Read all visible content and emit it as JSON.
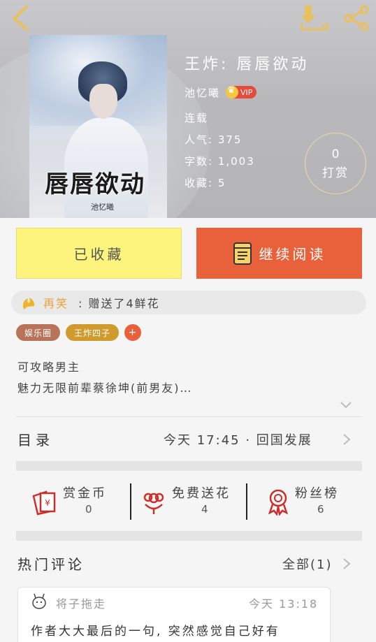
{
  "book": {
    "cover_title": "唇唇欲动",
    "cover_author": "池忆曦",
    "title": "王炸: 唇唇欲动",
    "author": "池忆曦",
    "vip_label": "VIP",
    "status": "连载",
    "popularity": "人气: 375",
    "word_count": "字数: 1,003",
    "favorites": "收藏: 5"
  },
  "tip": {
    "count": "0",
    "label": "打赏"
  },
  "actions": {
    "collect_label": "已收藏",
    "read_label": "继续阅读"
  },
  "gift": {
    "user": "再笑",
    "text": ": 赠送了4鲜花"
  },
  "tags": [
    "娱乐圈",
    "王炸四子"
  ],
  "tag_add": "+",
  "description": [
    "可攻略男主",
    "魅力无限前辈蔡徐坤(前男友)…"
  ],
  "toc": {
    "label": "目录",
    "latest": "今天 17:45 · 回国发展"
  },
  "stats": [
    {
      "label": "赏金币",
      "value": "0",
      "icon": "red-envelope-icon"
    },
    {
      "label": "免费送花",
      "value": "4",
      "icon": "flower-icon"
    },
    {
      "label": "粉丝榜",
      "value": "6",
      "icon": "medal-icon"
    }
  ],
  "comments_section": {
    "title": "热门评论",
    "all_label": "全部(1)"
  },
  "comment": {
    "user": "将子拖走",
    "time": "今天 13:18",
    "text": "作者大大最后的一句, 突然感觉自己好有"
  },
  "colors": {
    "collect_bg": "#fdf47e",
    "read_bg": "#e8613a",
    "accent_orange": "#e8a23a",
    "icon_red": "#c9302c"
  }
}
